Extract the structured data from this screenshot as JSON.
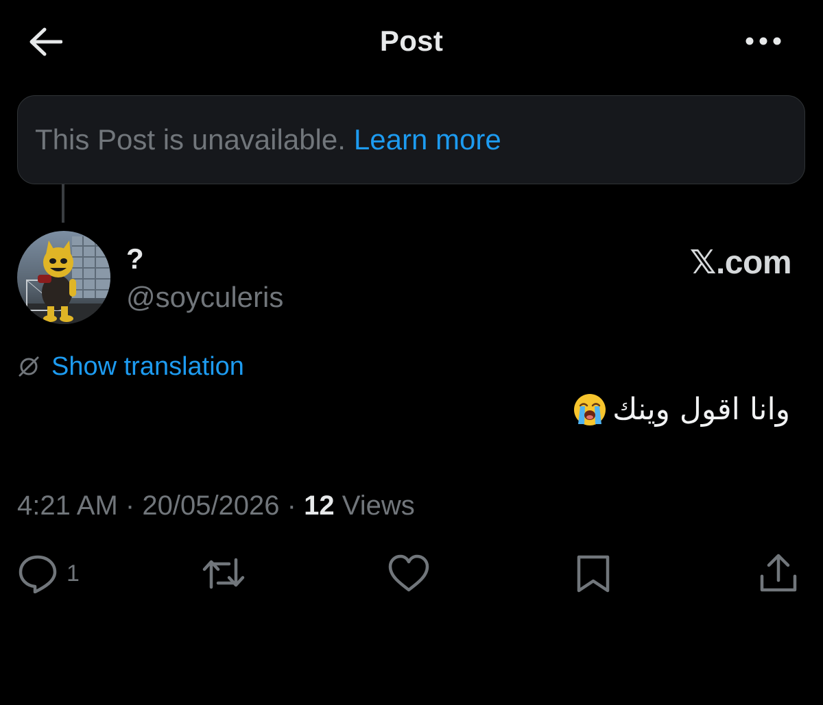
{
  "header": {
    "title": "Post",
    "back_icon": "arrow-left-icon",
    "more_icon": "more-horizontal-icon"
  },
  "notice": {
    "text": "This Post is unavailable.",
    "link_label": "Learn more"
  },
  "author": {
    "display_name": "?",
    "handle": "@soyculeris",
    "avatar_icon": "mascot-avatar"
  },
  "brand": {
    "label": "𝕏.com"
  },
  "translation": {
    "label": "Show translation",
    "icon": "globe-slash-icon"
  },
  "post": {
    "text": "وانا اقول وينك",
    "emoji": "loudly-crying-face-emoji"
  },
  "meta": {
    "time": "4:21 AM",
    "separator": "·",
    "date": "20/05/2026",
    "views_count": "12",
    "views_label": "Views"
  },
  "actions": {
    "reply_count": "1",
    "reply_icon": "reply-icon",
    "repost_icon": "repost-icon",
    "like_icon": "heart-icon",
    "bookmark_icon": "bookmark-icon",
    "share_icon": "share-icon"
  },
  "colors": {
    "background": "#000000",
    "accent": "#1d9bf0",
    "muted_text": "#71767b",
    "primary_text": "#e7e9ea",
    "notice_bg": "#16181c"
  }
}
